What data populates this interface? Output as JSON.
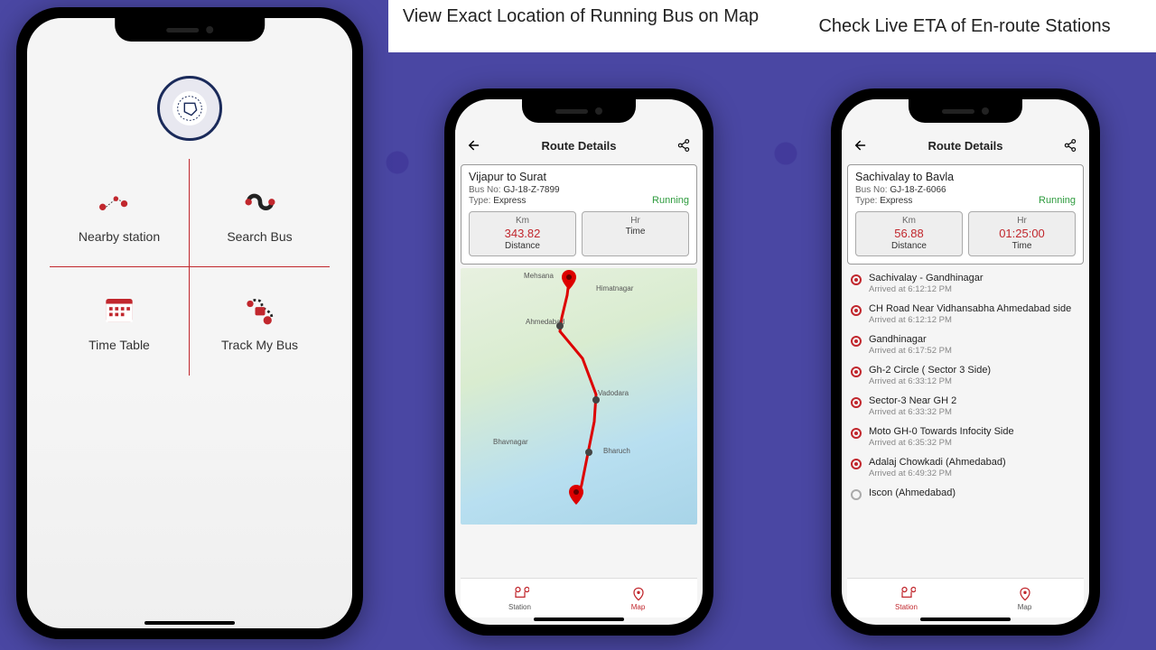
{
  "captions": {
    "map": "View Exact Location of Running Bus on Map",
    "eta": "Check Live ETA of En-route Stations"
  },
  "phone1": {
    "menu": {
      "nearby": "Nearby station",
      "search": "Search Bus",
      "timetable": "Time Table",
      "track": "Track My Bus"
    }
  },
  "routeDetailsTitle": "Route Details",
  "phone2": {
    "route": "Vijapur to Surat",
    "busNoLabel": "Bus No:",
    "busNo": "GJ-18-Z-7899",
    "typeLabel": "Type:",
    "type": "Express",
    "status": "Running",
    "kmLabel": "Km",
    "km": "343.82",
    "distance": "Distance",
    "hrLabel": "Hr",
    "hr": "",
    "time": "Time",
    "cities": {
      "mehsana": "Mehsana",
      "himatnagar": "Himatnagar",
      "ahmedabad": "Ahmedabad",
      "vadodara": "Vadodara",
      "bhavnagar": "Bhavnagar",
      "bharuch": "Bharuch"
    },
    "nav": {
      "station": "Station",
      "map": "Map"
    }
  },
  "phone3": {
    "route": "Sachivalay to Bavla",
    "busNoLabel": "Bus No:",
    "busNo": "GJ-18-Z-6066",
    "typeLabel": "Type:",
    "type": "Express",
    "status": "Running",
    "kmLabel": "Km",
    "km": "56.88",
    "distance": "Distance",
    "hrLabel": "Hr",
    "hr": "01:25:00",
    "time": "Time",
    "stations": [
      {
        "name": "Sachivalay - Gandhinagar",
        "time": "Arrived at  6:12:12 PM",
        "state": "filled"
      },
      {
        "name": "CH Road Near Vidhansabha Ahmedabad side",
        "time": "Arrived at  6:12:12 PM",
        "state": "filled"
      },
      {
        "name": "Gandhinagar",
        "time": "Arrived at  6:17:52 PM",
        "state": "filled"
      },
      {
        "name": "Gh-2 Circle ( Sector 3 Side)",
        "time": "Arrived at  6:33:12 PM",
        "state": "filled"
      },
      {
        "name": "Sector-3 Near GH 2",
        "time": "Arrived at  6:33:32 PM",
        "state": "filled"
      },
      {
        "name": "Moto GH-0 Towards Infocity  Side",
        "time": "Arrived at  6:35:32 PM",
        "state": "filled"
      },
      {
        "name": "Adalaj Chowkadi (Ahmedabad)",
        "time": "Arrived at  6:49:32 PM",
        "state": "filled"
      },
      {
        "name": "Iscon (Ahmedabad)",
        "time": "",
        "state": "empty"
      }
    ],
    "nav": {
      "station": "Station",
      "map": "Map"
    }
  }
}
